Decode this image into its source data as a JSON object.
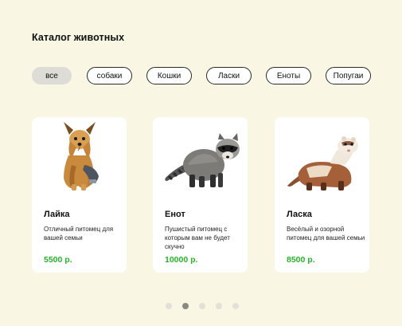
{
  "catalog": {
    "title": "Каталог животных"
  },
  "filters": [
    {
      "label": "все",
      "active": true
    },
    {
      "label": "собаки",
      "active": false
    },
    {
      "label": "Кошки",
      "active": false
    },
    {
      "label": "Ласки",
      "active": false
    },
    {
      "label": "Еноты",
      "active": false
    },
    {
      "label": "Попугаи",
      "active": false
    }
  ],
  "cards": [
    {
      "name": "Лайка",
      "description": "Отличный питомец для вашей семьи",
      "price": "5500 р.",
      "image": "yorkshire-terrier-image"
    },
    {
      "name": "Енот",
      "description": "Пушистый  питомец с которым вам не будет скучно",
      "price": "10000 р.",
      "image": "raccoon-image"
    },
    {
      "name": "Ласка",
      "description": "Весёлый и озорной питомец для вашей семьи",
      "price": "8500 р.",
      "image": "ferret-image"
    }
  ],
  "pagination": {
    "count": 5,
    "active_index": 1
  },
  "colors": {
    "background": "#f9f6e3",
    "card": "#ffffff",
    "price": "#27b32a",
    "active_chip": "#dedcd6",
    "active_dot": "#8a8984",
    "dot": "#e2e0d8"
  }
}
